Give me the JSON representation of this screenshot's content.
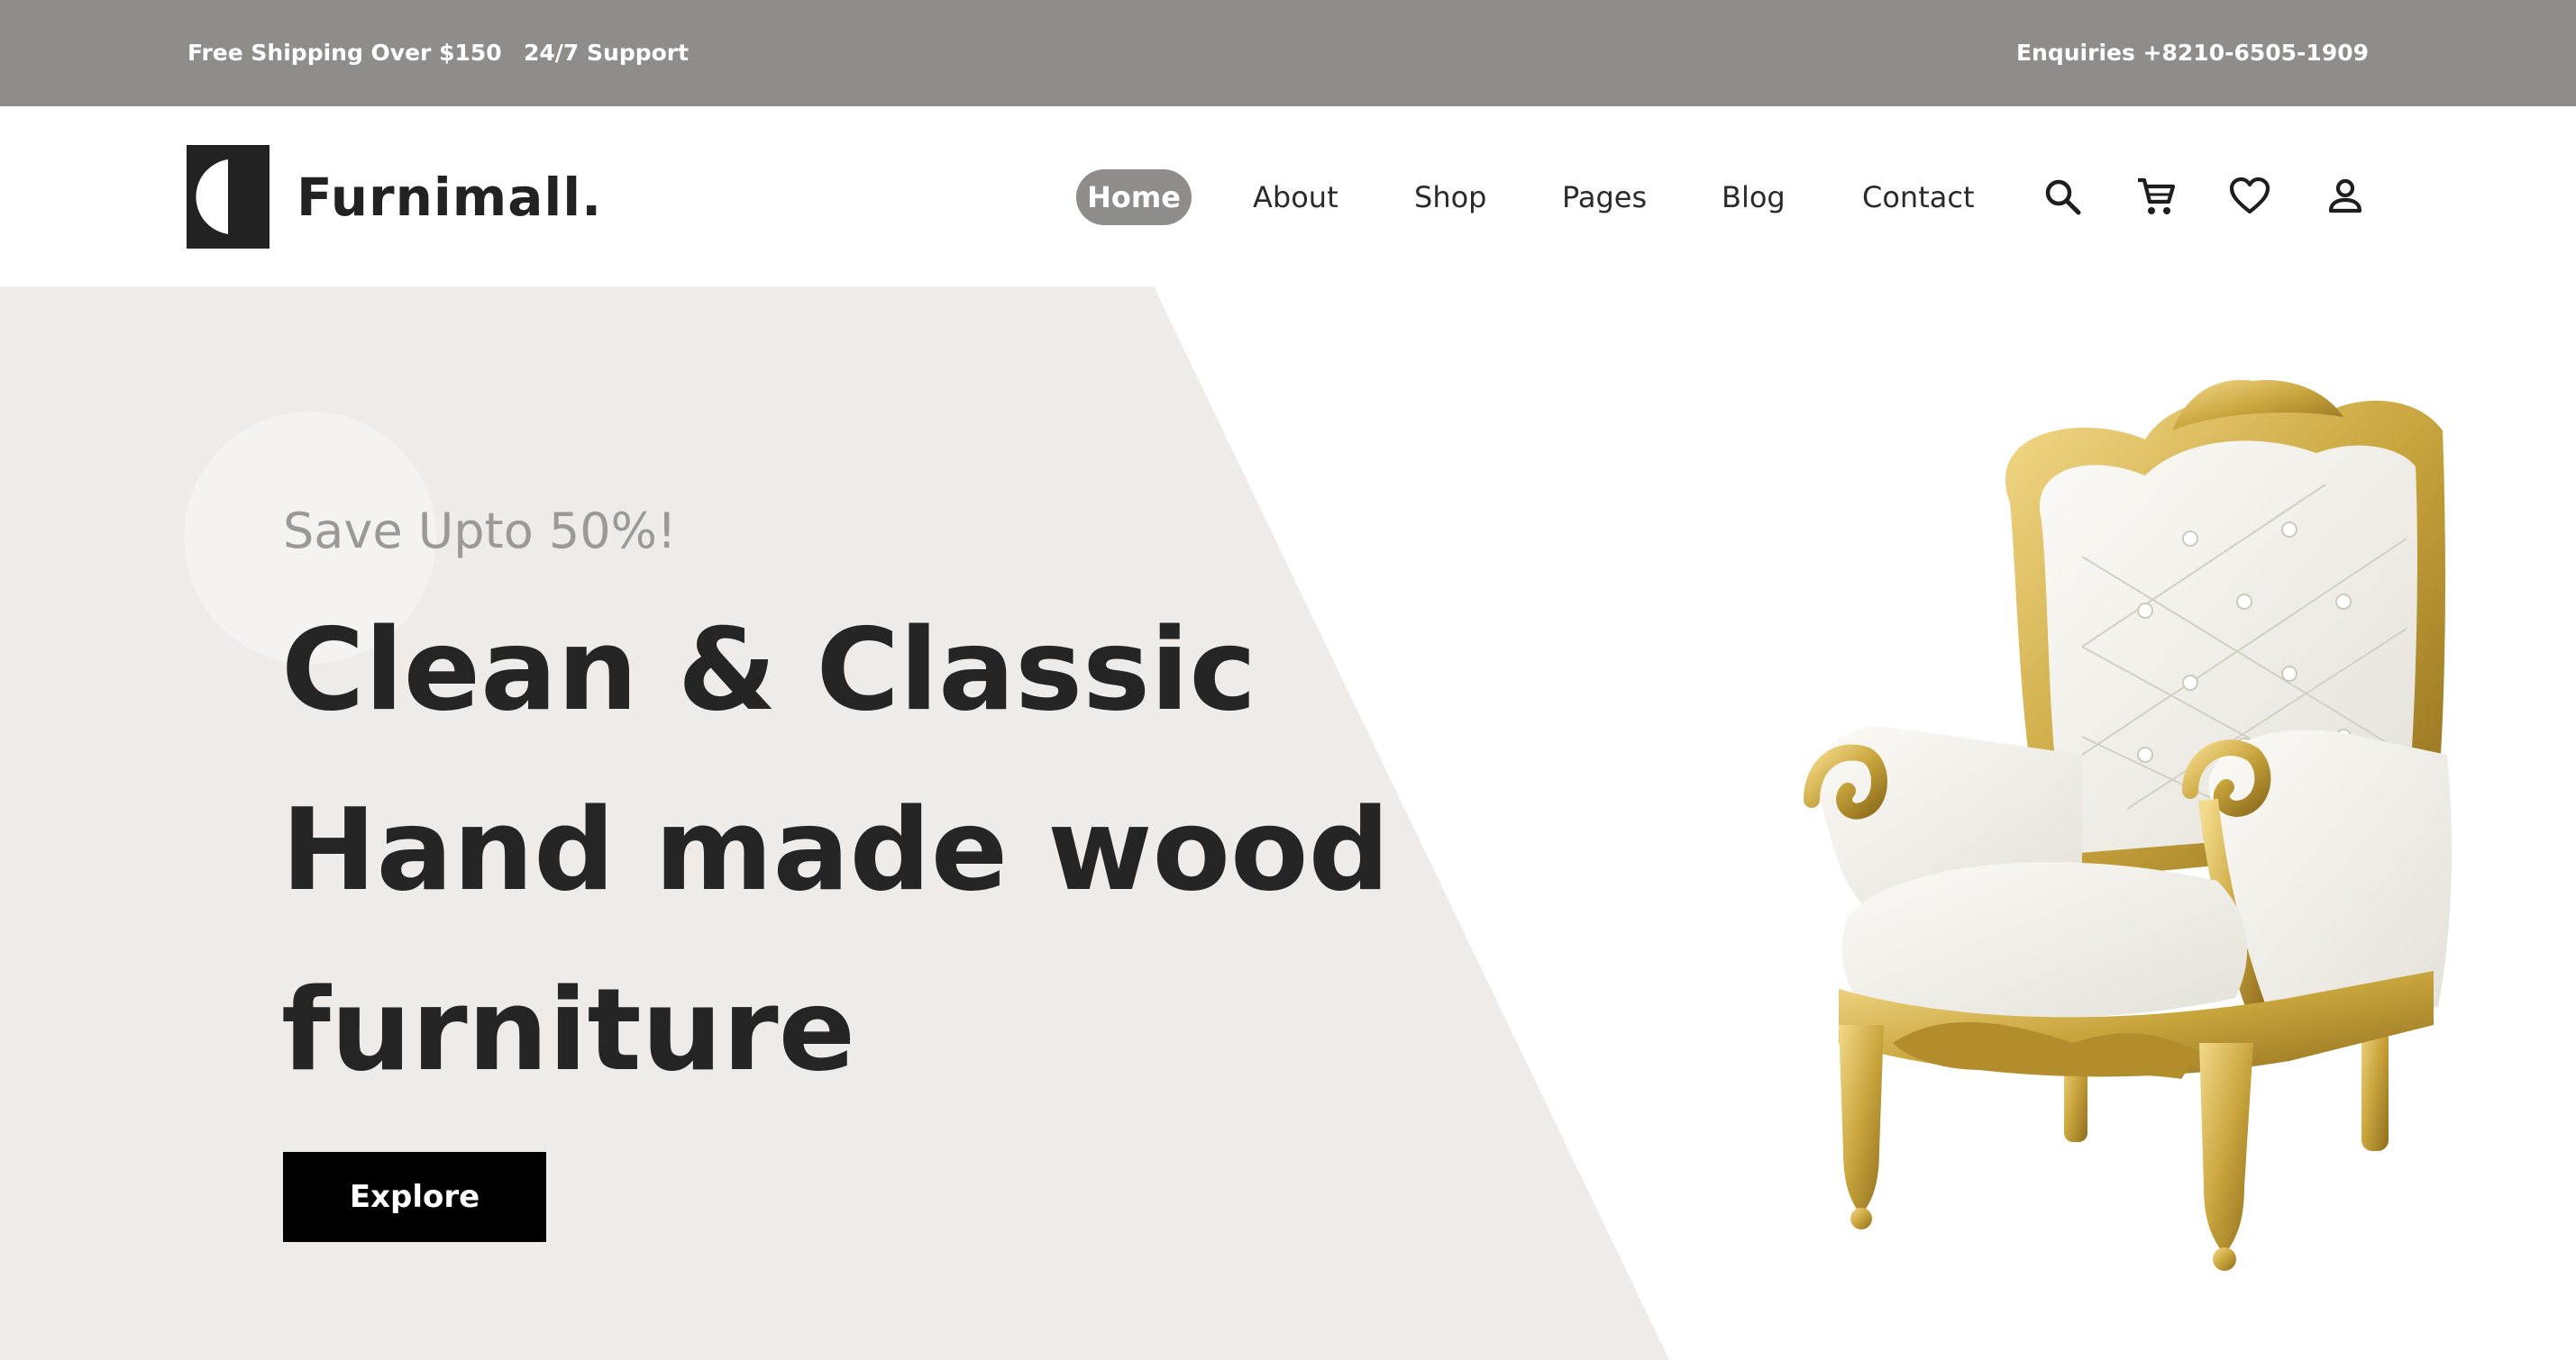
{
  "topbar": {
    "shipping": "Free Shipping Over $150",
    "support": "24/7 Support",
    "enquiry": "Enquiries +8210-6505-1909"
  },
  "brand": {
    "name": "Furnimall."
  },
  "nav": {
    "items": [
      {
        "label": "Home",
        "active": true
      },
      {
        "label": "About",
        "active": false
      },
      {
        "label": "Shop",
        "active": false
      },
      {
        "label": "Pages",
        "active": false
      },
      {
        "label": "Blog",
        "active": false
      },
      {
        "label": "Contact",
        "active": false
      }
    ],
    "icons": [
      "search-icon",
      "cart-icon",
      "heart-icon",
      "user-icon"
    ]
  },
  "hero": {
    "kicker": "Save Upto 50%!",
    "title_lines": [
      "Clean & Classic",
      "Hand made wood",
      "furniture"
    ],
    "cta": "Explore",
    "image": "armchair"
  },
  "colors": {
    "topbar_bg": "#8f8c89",
    "hero_panel": "#eeebe8",
    "accent_gold": "#c9a53d",
    "button_bg": "#000000"
  }
}
